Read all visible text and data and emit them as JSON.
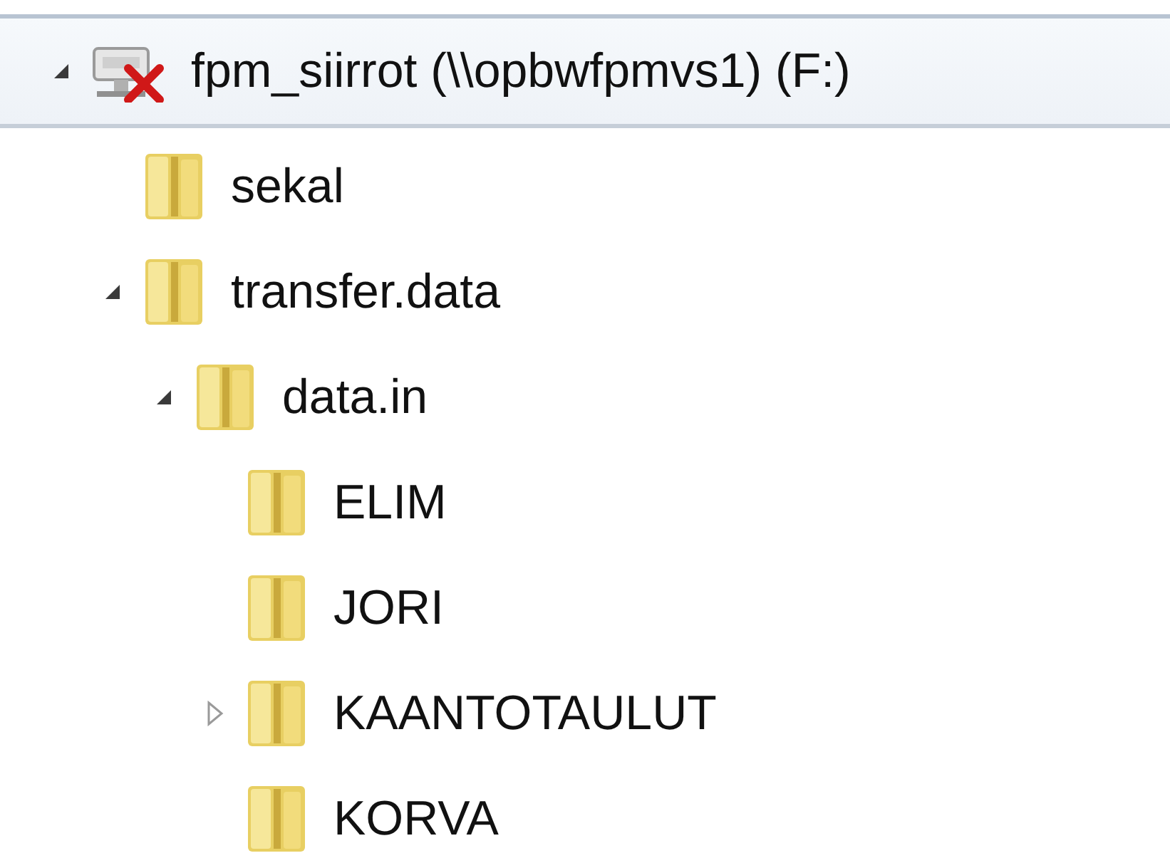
{
  "tree": [
    {
      "kind": "drive",
      "label": "fpm_siirrot (\\\\opbwfpmvs1) (F:)",
      "expanded": true,
      "selected": true,
      "children": [
        {
          "kind": "folder",
          "label": "sekal"
        },
        {
          "kind": "folder",
          "label": "transfer.data",
          "expanded": true,
          "children": [
            {
              "kind": "folder",
              "label": "data.in",
              "expanded": true,
              "children": [
                {
                  "kind": "folder",
                  "label": "ELIM"
                },
                {
                  "kind": "folder",
                  "label": "JORI"
                },
                {
                  "kind": "folder",
                  "label": "KAANTOTAULUT",
                  "expanded": false
                },
                {
                  "kind": "folder",
                  "label": "KORVA"
                }
              ]
            }
          ]
        }
      ]
    }
  ]
}
